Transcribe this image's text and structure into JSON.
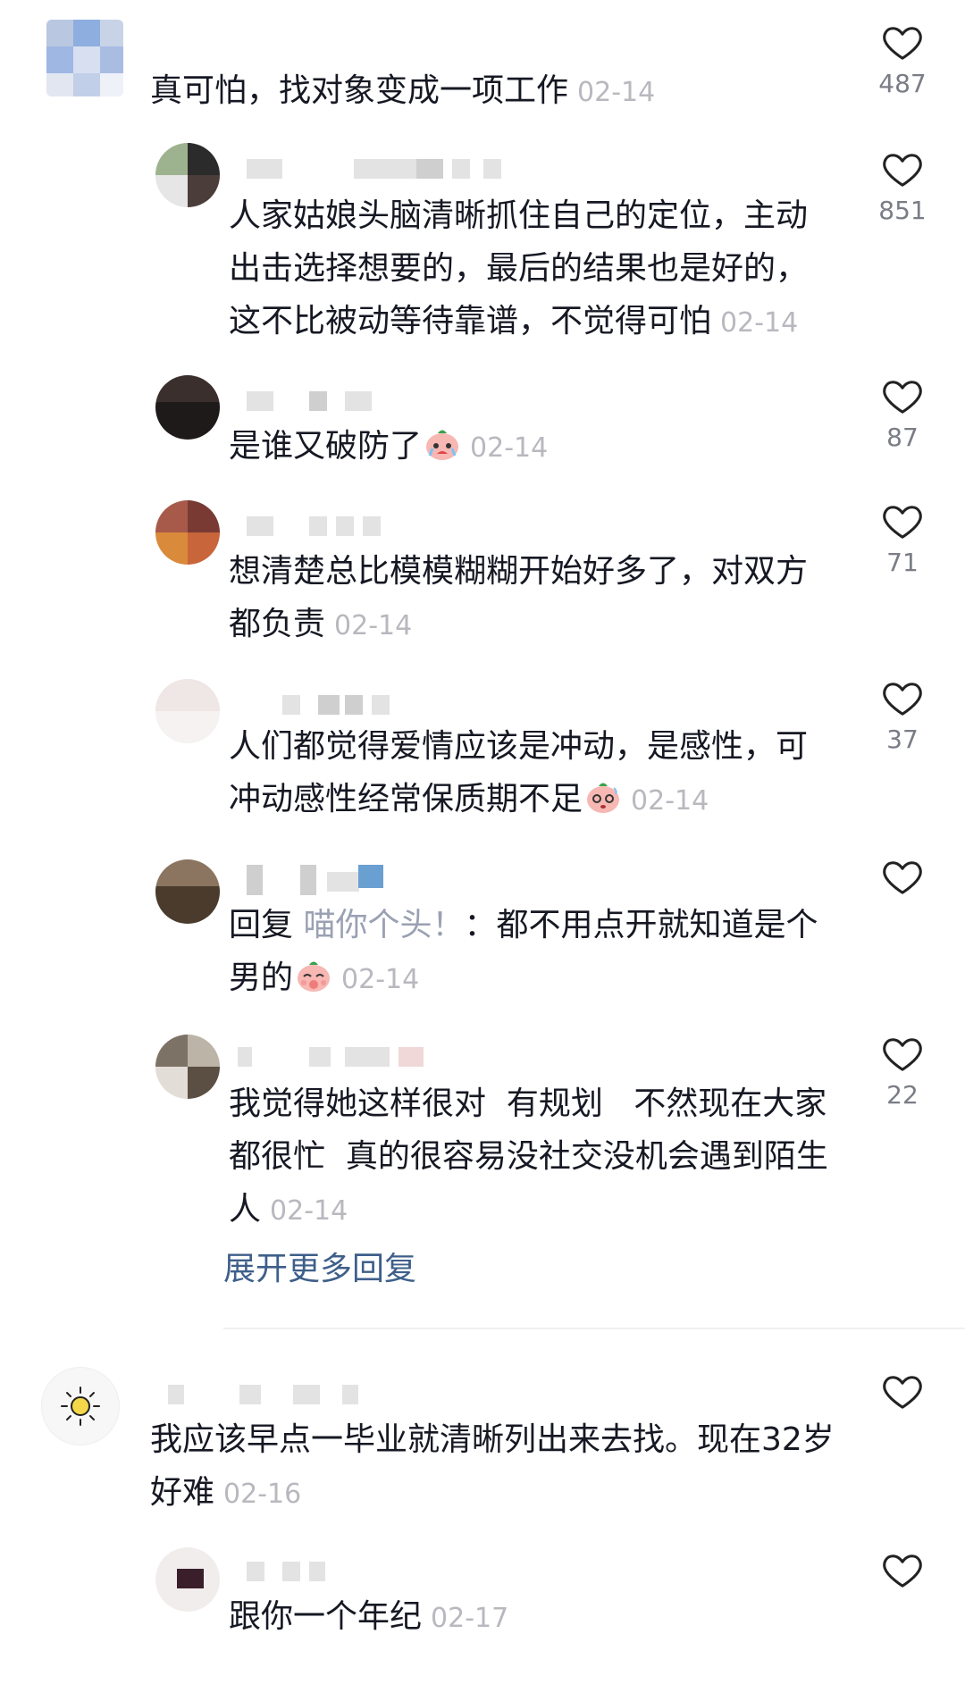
{
  "comments": {
    "c1": {
      "text": "真可怕，找对象变成一项工作",
      "date": "02-14",
      "likes": "487"
    },
    "r1": {
      "text": "人家姑娘头脑清晰抓住自己的定位，主动出击选择想要的，最后的结果也是好的，这不比被动等待靠谱，不觉得可怕",
      "date": "02-14",
      "likes": "851"
    },
    "r2": {
      "text": "是谁又破防了",
      "date": "02-14",
      "likes": "87",
      "emoji": "crying-face-icon"
    },
    "r3": {
      "text": "想清楚总比模模糊糊开始好多了，对双方都负责",
      "date": "02-14",
      "likes": "71"
    },
    "r4": {
      "text": "人们都觉得爱情应该是冲动，是感性，可冲动感性经常保质期不足",
      "date": "02-14",
      "likes": "37",
      "emoji": "dazed-face-icon"
    },
    "r5": {
      "prefix": "回复 ",
      "mention": "喵你个头！",
      "text": "：都不用点开就知道是个男的",
      "date": "02-14",
      "likes": "",
      "emoji": "shy-face-icon"
    },
    "r6": {
      "text": "我觉得她这样很对  有规划   不然现在大家都很忙  真的很容易没社交没机会遇到陌生人",
      "date": "02-14",
      "likes": "22"
    },
    "c2": {
      "text": "我应该早点一毕业就清晰列出来去找。现在32岁好难",
      "date": "02-16",
      "likes": ""
    },
    "r7": {
      "text": "跟你一个年纪",
      "date": "02-17",
      "likes": ""
    }
  },
  "expand_replies": "展开更多回复",
  "colors": {
    "text": "#161823",
    "date": "#b8b8bf",
    "like_count": "#7a7d86",
    "link": "#3e5f8a",
    "mention": "#9aa1b3"
  },
  "icons": [
    "heart-outline-icon",
    "crying-face-icon",
    "dazed-face-icon",
    "shy-face-icon",
    "sun-avatar-icon"
  ]
}
